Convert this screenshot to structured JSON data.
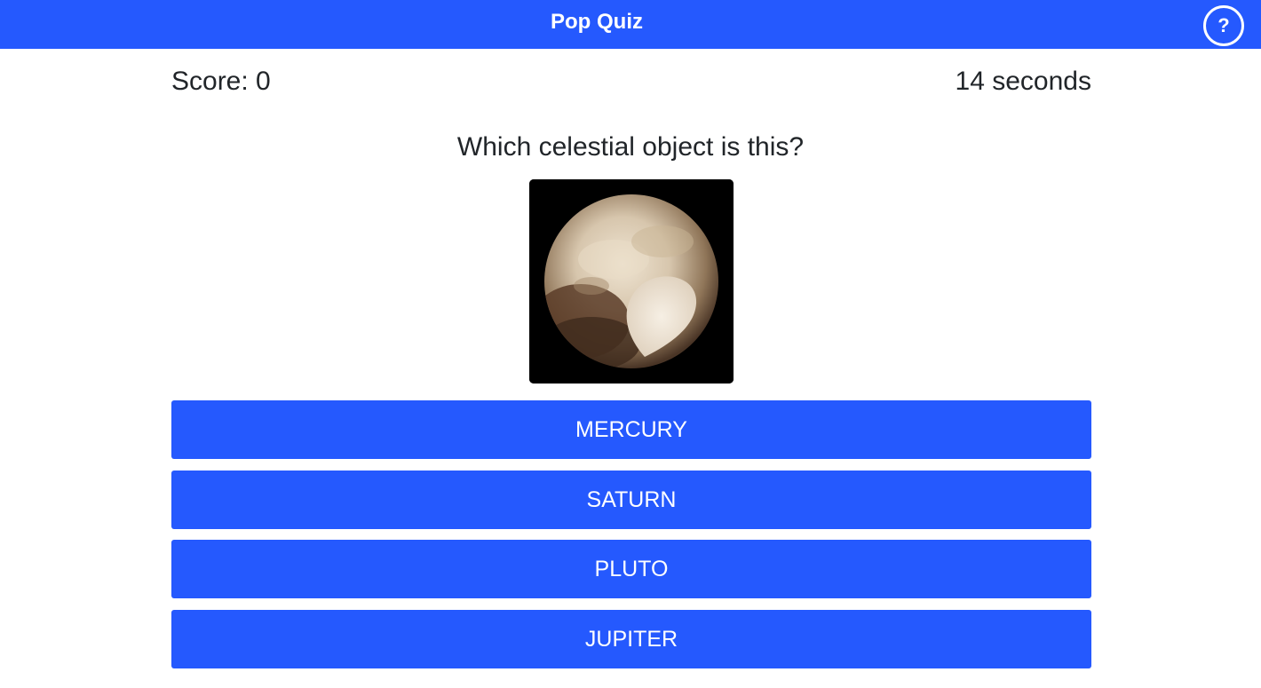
{
  "header": {
    "title": "Pop Quiz",
    "help_label": "?"
  },
  "status": {
    "score": "Score: 0",
    "timer": "14 seconds"
  },
  "question": {
    "text": "Which celestial object is this?",
    "image_icon": "pluto-image"
  },
  "answers": [
    {
      "label": "MERCURY"
    },
    {
      "label": "SATURN"
    },
    {
      "label": "PLUTO"
    },
    {
      "label": "JUPITER"
    }
  ],
  "colors": {
    "accent": "#2559fe",
    "text": "#212529",
    "background": "#ffffff"
  }
}
